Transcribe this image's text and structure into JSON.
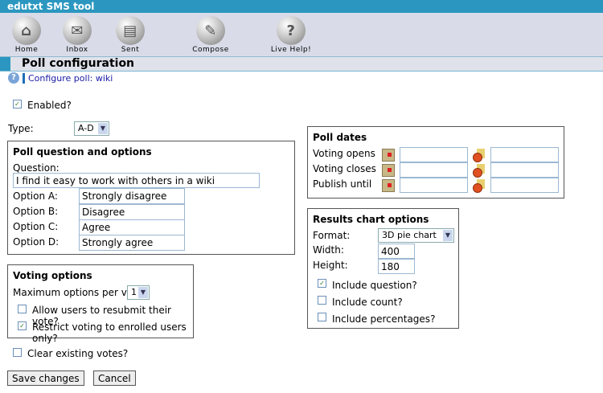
{
  "app": {
    "title": "edutxt SMS tool"
  },
  "toolbar": [
    {
      "label": "Home",
      "icon": "home-icon"
    },
    {
      "label": "Inbox",
      "icon": "inbox-icon"
    },
    {
      "label": "Sent",
      "icon": "sent-icon"
    },
    {
      "label": "Compose",
      "icon": "compose-icon"
    },
    {
      "label": "Live Help!",
      "icon": "help-icon"
    }
  ],
  "page": {
    "title": "Poll configuration",
    "subtitle": "Configure poll: wiki"
  },
  "enabled": {
    "label": "Enabled?",
    "checked": true
  },
  "type": {
    "label": "Type:",
    "value": "A-D"
  },
  "question": {
    "heading": "Poll question and options",
    "label": "Question:",
    "value": "I find it easy to work with others in a wiki",
    "options": [
      {
        "label": "Option A:",
        "value": "Strongly disagree"
      },
      {
        "label": "Option B:",
        "value": "Disagree"
      },
      {
        "label": "Option C:",
        "value": "Agree"
      },
      {
        "label": "Option D:",
        "value": "Strongly agree"
      }
    ]
  },
  "voting": {
    "heading": "Voting options",
    "max_label": "Maximum options per vote:",
    "max_value": "1",
    "resubmit": {
      "label": "Allow users to resubmit their vote?",
      "checked": false
    },
    "restrict": {
      "label": "Restrict voting to enrolled users only?",
      "checked": true
    }
  },
  "clear": {
    "label": "Clear existing votes?",
    "checked": false
  },
  "dates": {
    "heading": "Poll dates",
    "rows": [
      {
        "label": "Voting opens",
        "date": "",
        "time": ""
      },
      {
        "label": "Voting closes",
        "date": "",
        "time": ""
      },
      {
        "label": "Publish until",
        "date": "",
        "time": ""
      }
    ]
  },
  "chart": {
    "heading": "Results chart options",
    "format_label": "Format:",
    "format_value": "3D pie chart",
    "width_label": "Width:",
    "width_value": "400",
    "height_label": "Height:",
    "height_value": "180",
    "include_question": {
      "label": "Include question?",
      "checked": true
    },
    "include_count": {
      "label": "Include count?",
      "checked": false
    },
    "include_percentages": {
      "label": "Include percentages?",
      "checked": false
    }
  },
  "buttons": {
    "save": "Save changes",
    "cancel": "Cancel"
  }
}
